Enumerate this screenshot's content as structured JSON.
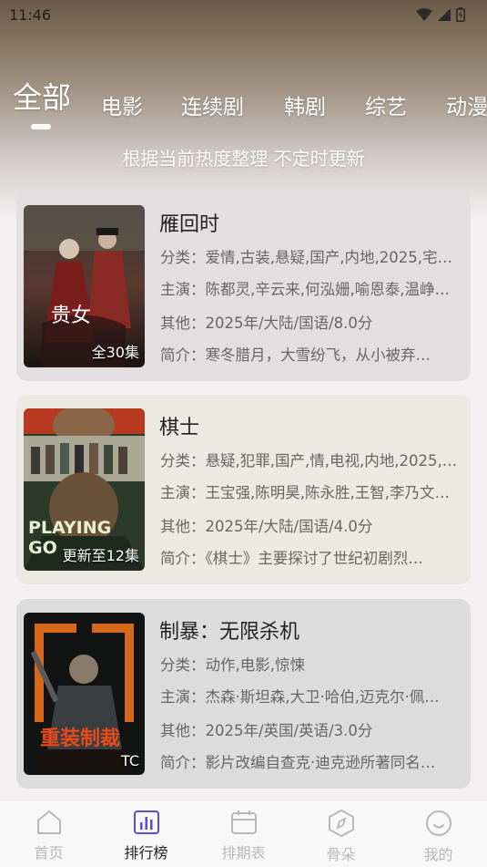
{
  "status": {
    "time": "11:46",
    "icons": [
      "wifi-icon",
      "signal-icon",
      "battery-icon"
    ]
  },
  "tabs": [
    {
      "label": "全部",
      "active": true
    },
    {
      "label": "电影"
    },
    {
      "label": "连续剧"
    },
    {
      "label": "韩剧"
    },
    {
      "label": "综艺"
    },
    {
      "label": "动漫"
    }
  ],
  "subtitle": "根据当前热度整理 不定时更新",
  "cards": [
    {
      "title": "雁回时",
      "episode": "全30集",
      "poster_text": "贵女",
      "category": "分类：爱情,古装,悬疑,国产,内地,2025,宅…",
      "cast": "主演：陈都灵,辛云来,何泓姗,喻恩泰,温峥…",
      "other": "其他：2025年/大陆/国语/8.0分",
      "intro": "简介：寒冬腊月，大雪纷飞，从小被弃…"
    },
    {
      "title": "棋士",
      "episode": "更新至12集",
      "poster_text": "PLAYING GO",
      "category": "分类：悬疑,犯罪,国产,情,电视,内地,2025,…",
      "cast": "主演：王宝强,陈明昊,陈永胜,王智,李乃文…",
      "other": "其他：2025年/大陆/国语/4.0分",
      "intro": "简介：《棋士》主要探讨了世纪初剧烈…"
    },
    {
      "title": "制暴：无限杀机",
      "episode": "TC",
      "poster_text": "重装制裁",
      "category": "分类：动作,电影,惊悚",
      "cast": "主演：杰森·斯坦森,大卫·哈伯,迈克尔·佩…",
      "other": "其他：2025年/英国/英语/3.0分",
      "intro": "简介：影片改编自查克·迪克逊所著同名…"
    }
  ],
  "nav": [
    {
      "label": "首页",
      "icon": "home-icon"
    },
    {
      "label": "排行榜",
      "icon": "chart-icon",
      "active": true
    },
    {
      "label": "排期表",
      "icon": "calendar-icon"
    },
    {
      "label": "骨朵",
      "icon": "compass-icon"
    },
    {
      "label": "我的",
      "icon": "smile-icon"
    }
  ],
  "colors": {
    "accent": "#5b4bd6",
    "text": "#222222",
    "meta": "#666666",
    "nav_inactive": "#b8b8b8"
  }
}
